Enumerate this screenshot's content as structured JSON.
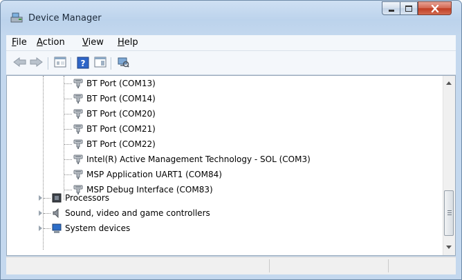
{
  "window": {
    "title": "Device Manager"
  },
  "menu": {
    "items": [
      {
        "label": "File",
        "accel": "F",
        "rest": "ile"
      },
      {
        "label": "Action",
        "accel": "A",
        "rest": "ction"
      },
      {
        "label": "View",
        "accel": "V",
        "rest": "iew"
      },
      {
        "label": "Help",
        "accel": "H",
        "rest": "elp"
      }
    ]
  },
  "toolbar": {
    "buttons": [
      "back-arrow-icon",
      "forward-arrow-icon",
      "properties-icon",
      "help-icon",
      "show-console-tree-icon",
      "scan-hardware-icon"
    ]
  },
  "tree": {
    "ports": [
      "BT Port (COM13)",
      "BT Port (COM14)",
      "BT Port (COM20)",
      "BT Port (COM21)",
      "BT Port (COM22)",
      "Intel(R) Active Management Technology - SOL (COM3)",
      "MSP Application UART1 (COM84)",
      "MSP Debug Interface (COM83)"
    ],
    "categories": [
      {
        "label": "Processors",
        "icon": "processor-icon"
      },
      {
        "label": "Sound, video and game controllers",
        "icon": "speaker-icon"
      },
      {
        "label": "System devices",
        "icon": "computer-icon"
      }
    ]
  },
  "colors": {
    "frame": "#c4d8ee",
    "close_button": "#c03d23",
    "toolbar_bg": "#f4f7fb"
  }
}
